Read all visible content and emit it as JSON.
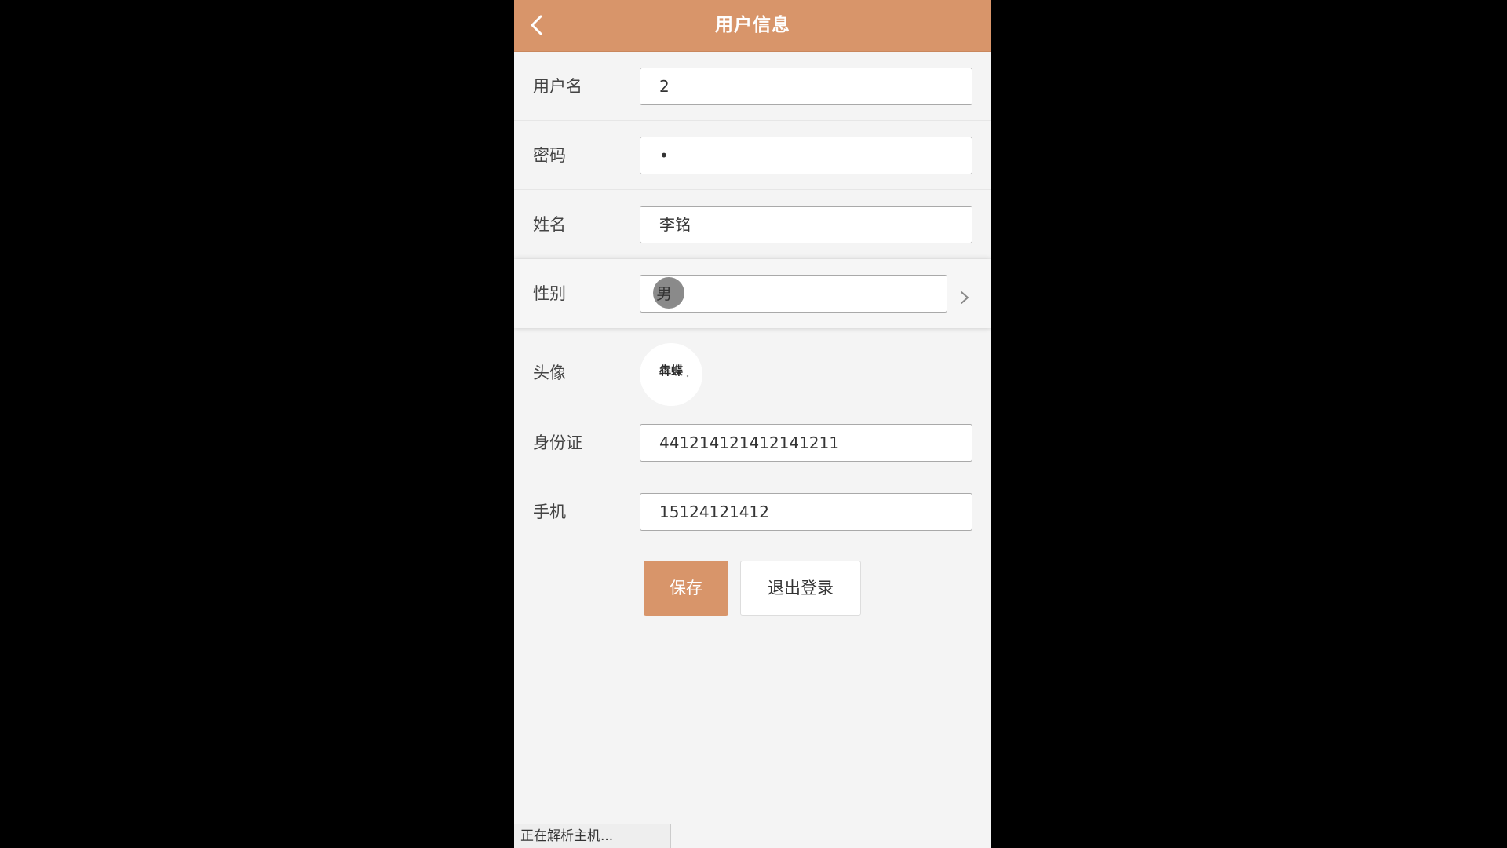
{
  "header": {
    "title": "用户信息",
    "back_icon": "chevron-left-icon",
    "background_color": "#d8956a"
  },
  "form": {
    "username": {
      "label": "用户名",
      "value": "2"
    },
    "password": {
      "label": "密码",
      "value": "•"
    },
    "name": {
      "label": "姓名",
      "value": "李铭"
    },
    "gender": {
      "label": "性别",
      "value": "男",
      "icon": "chevron-right-icon"
    },
    "avatar": {
      "label": "头像",
      "image_text": "犇蝶"
    },
    "id_card": {
      "label": "身份证",
      "value": "441214121412141211"
    },
    "phone": {
      "label": "手机",
      "value": "15124121412"
    }
  },
  "actions": {
    "save_label": "保存",
    "logout_label": "退出登录",
    "accent_color": "#d8956a"
  },
  "status_bar": {
    "text": "正在解析主机..."
  }
}
